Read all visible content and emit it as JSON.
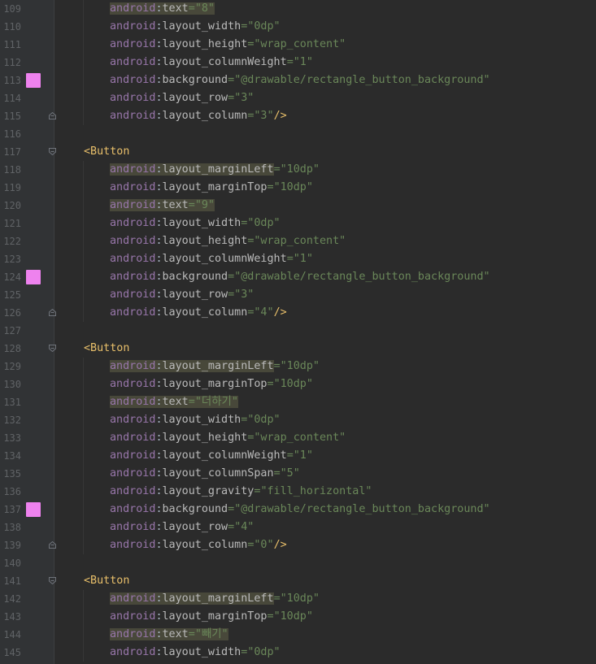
{
  "editor": {
    "colors": {
      "background": "#2b2b2b",
      "gutter": "#313335",
      "namespace": "#9876aa",
      "attribute": "#bababa",
      "value": "#6a8759",
      "tag": "#e8bf6a",
      "swatch": "#ee82ee",
      "highlight": "#48483a"
    },
    "lines": [
      {
        "num": "109",
        "ns": "android",
        "attr": "text",
        "val": "\"8\"",
        "hl": true
      },
      {
        "num": "110",
        "ns": "android",
        "attr": "layout_width",
        "val": "\"0dp\""
      },
      {
        "num": "111",
        "ns": "android",
        "attr": "layout_height",
        "val": "\"wrap_content\""
      },
      {
        "num": "112",
        "ns": "android",
        "attr": "layout_columnWeight",
        "val": "\"1\""
      },
      {
        "num": "113",
        "ns": "android",
        "attr": "background",
        "val": "\"@drawable/rectangle_button_background\"",
        "swatch": true
      },
      {
        "num": "114",
        "ns": "android",
        "attr": "layout_row",
        "val": "\"3\""
      },
      {
        "num": "115",
        "ns": "android",
        "attr": "layout_column",
        "val": "\"3\"",
        "close": "/>",
        "fold": "end"
      },
      {
        "num": "116",
        "blank": true
      },
      {
        "num": "117",
        "tag": "<Button",
        "fold": "start"
      },
      {
        "num": "118",
        "ns": "android",
        "attr": "layout_marginLeft",
        "val": "\"10dp\"",
        "hl": true
      },
      {
        "num": "119",
        "ns": "android",
        "attr": "layout_marginTop",
        "val": "\"10dp\""
      },
      {
        "num": "120",
        "ns": "android",
        "attr": "text",
        "val": "\"9\"",
        "hl": true
      },
      {
        "num": "121",
        "ns": "android",
        "attr": "layout_width",
        "val": "\"0dp\""
      },
      {
        "num": "122",
        "ns": "android",
        "attr": "layout_height",
        "val": "\"wrap_content\""
      },
      {
        "num": "123",
        "ns": "android",
        "attr": "layout_columnWeight",
        "val": "\"1\""
      },
      {
        "num": "124",
        "ns": "android",
        "attr": "background",
        "val": "\"@drawable/rectangle_button_background\"",
        "swatch": true
      },
      {
        "num": "125",
        "ns": "android",
        "attr": "layout_row",
        "val": "\"3\""
      },
      {
        "num": "126",
        "ns": "android",
        "attr": "layout_column",
        "val": "\"4\"",
        "close": "/>",
        "fold": "end"
      },
      {
        "num": "127",
        "blank": true
      },
      {
        "num": "128",
        "tag": "<Button",
        "fold": "start"
      },
      {
        "num": "129",
        "ns": "android",
        "attr": "layout_marginLeft",
        "val": "\"10dp\"",
        "hl": true
      },
      {
        "num": "130",
        "ns": "android",
        "attr": "layout_marginTop",
        "val": "\"10dp\""
      },
      {
        "num": "131",
        "ns": "android",
        "attr": "text",
        "val": "\"더하기\"",
        "hl": true
      },
      {
        "num": "132",
        "ns": "android",
        "attr": "layout_width",
        "val": "\"0dp\""
      },
      {
        "num": "133",
        "ns": "android",
        "attr": "layout_height",
        "val": "\"wrap_content\""
      },
      {
        "num": "134",
        "ns": "android",
        "attr": "layout_columnWeight",
        "val": "\"1\""
      },
      {
        "num": "135",
        "ns": "android",
        "attr": "layout_columnSpan",
        "val": "\"5\""
      },
      {
        "num": "136",
        "ns": "android",
        "attr": "layout_gravity",
        "val": "\"fill_horizontal\""
      },
      {
        "num": "137",
        "ns": "android",
        "attr": "background",
        "val": "\"@drawable/rectangle_button_background\"",
        "swatch": true
      },
      {
        "num": "138",
        "ns": "android",
        "attr": "layout_row",
        "val": "\"4\""
      },
      {
        "num": "139",
        "ns": "android",
        "attr": "layout_column",
        "val": "\"0\"",
        "close": "/>",
        "fold": "end"
      },
      {
        "num": "140",
        "blank": true
      },
      {
        "num": "141",
        "tag": "<Button",
        "fold": "start"
      },
      {
        "num": "142",
        "ns": "android",
        "attr": "layout_marginLeft",
        "val": "\"10dp\"",
        "hl": true
      },
      {
        "num": "143",
        "ns": "android",
        "attr": "layout_marginTop",
        "val": "\"10dp\""
      },
      {
        "num": "144",
        "ns": "android",
        "attr": "text",
        "val": "\"빼기\"",
        "hl": true
      },
      {
        "num": "145",
        "ns": "android",
        "attr": "layout_width",
        "val": "\"0dp\""
      }
    ]
  }
}
